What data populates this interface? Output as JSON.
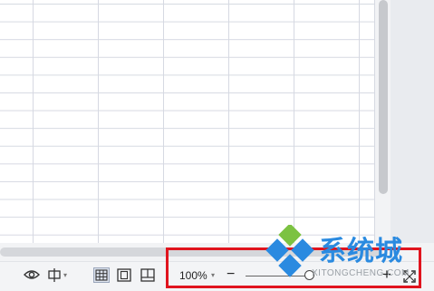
{
  "status_bar": {
    "zoom_percent": "100%",
    "zoom_caret": "▾",
    "zoom_minus": "−",
    "zoom_plus": "+",
    "zoom_level": 1.0
  },
  "watermark": {
    "cn_text": "系统城",
    "url_text": "XITONGCHENG.COM"
  },
  "colors": {
    "highlight": "#e0141e",
    "watermark_blue": "#2a8ae0",
    "watermark_green": "#7cc242"
  }
}
